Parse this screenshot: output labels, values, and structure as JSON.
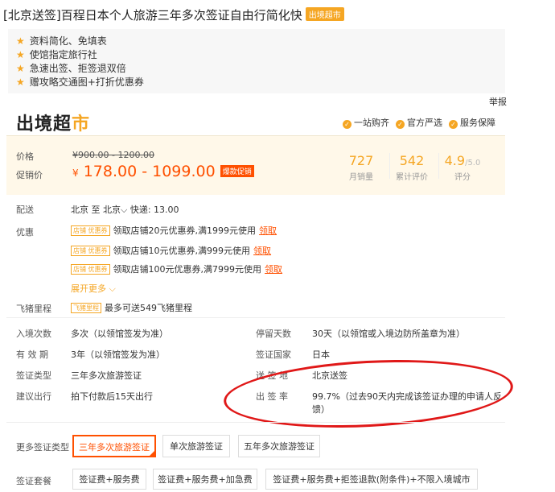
{
  "title": {
    "text": "[北京送签]百程日本个人旅游三年多次签证自由行简化快",
    "badge": "出境超市"
  },
  "features": [
    "资料简化、免填表",
    "使馆指定旅行社",
    "急速出签、拒签退双倍",
    "赠攻略交通图+打折优惠券"
  ],
  "report_link": "举报",
  "shop": {
    "logo_main": "出境超",
    "logo_end": "市",
    "promises": [
      "一站购齐",
      "官方严选",
      "服务保障"
    ]
  },
  "price": {
    "price_label": "价格",
    "original": "¥900.00 - 1200.00",
    "promo_label": "促销价",
    "currency": "¥",
    "range": "178.00 - 1099.00",
    "hot_badge": "爆款促销"
  },
  "stats": [
    {
      "value": "727",
      "suffix": "",
      "label": "月销量"
    },
    {
      "value": "542",
      "suffix": "",
      "label": "累计评价"
    },
    {
      "value": "4.9",
      "suffix": "/5.0",
      "label": "评分"
    }
  ],
  "shipping": {
    "label": "配送",
    "value": "北京 至 北京⌵  快递: 13.00"
  },
  "coupons": {
    "label": "优惠",
    "tag": "店铺 优惠券",
    "items": [
      {
        "text": "领取店铺20元优惠券,满1999元使用",
        "link": "领取"
      },
      {
        "text": "领取店铺10元优惠券,满999元使用",
        "link": "领取"
      },
      {
        "text": "领取店铺100元优惠券,满7999元使用",
        "link": "领取"
      }
    ],
    "expand": "展开更多 ⌵"
  },
  "miles": {
    "label": "飞猪里程",
    "tag": "飞猪里程",
    "text": "最多可送549飞猪里程"
  },
  "specs": [
    {
      "label": "入境次数",
      "value": "多次（以领馆签发为准）"
    },
    {
      "label": "停留天数",
      "value": "30天（以领馆或入境边防所盖章为准）"
    },
    {
      "label": "有 效 期",
      "value": "3年（以领馆签发为准）"
    },
    {
      "label": "签证国家",
      "value": "日本"
    },
    {
      "label": "签证类型",
      "value": "三年多次旅游签证"
    },
    {
      "label": "送 签 地",
      "value": "北京送签"
    },
    {
      "label": "建议出行",
      "value": "拍下付款后15天出行"
    },
    {
      "label": "出 签 率",
      "value": "99.7%（过去90天内完成该签证办理的申请人反"
    },
    {
      "label": "",
      "value": "馈）"
    }
  ],
  "visa_types": {
    "label": "更多签证类型",
    "options": [
      "三年多次旅游签证",
      "单次旅游签证",
      "五年多次旅游签证"
    ],
    "selected": 0
  },
  "packages": {
    "label": "签证套餐",
    "options": [
      "签证费+服务费",
      "签证费+服务费+加急费",
      "签证费+服务费+拒签退款(附条件)+不限入境城市"
    ]
  },
  "colors": {
    "accent": "#f5a623",
    "price": "#ff5000",
    "annotation_circle": "#e01818"
  }
}
